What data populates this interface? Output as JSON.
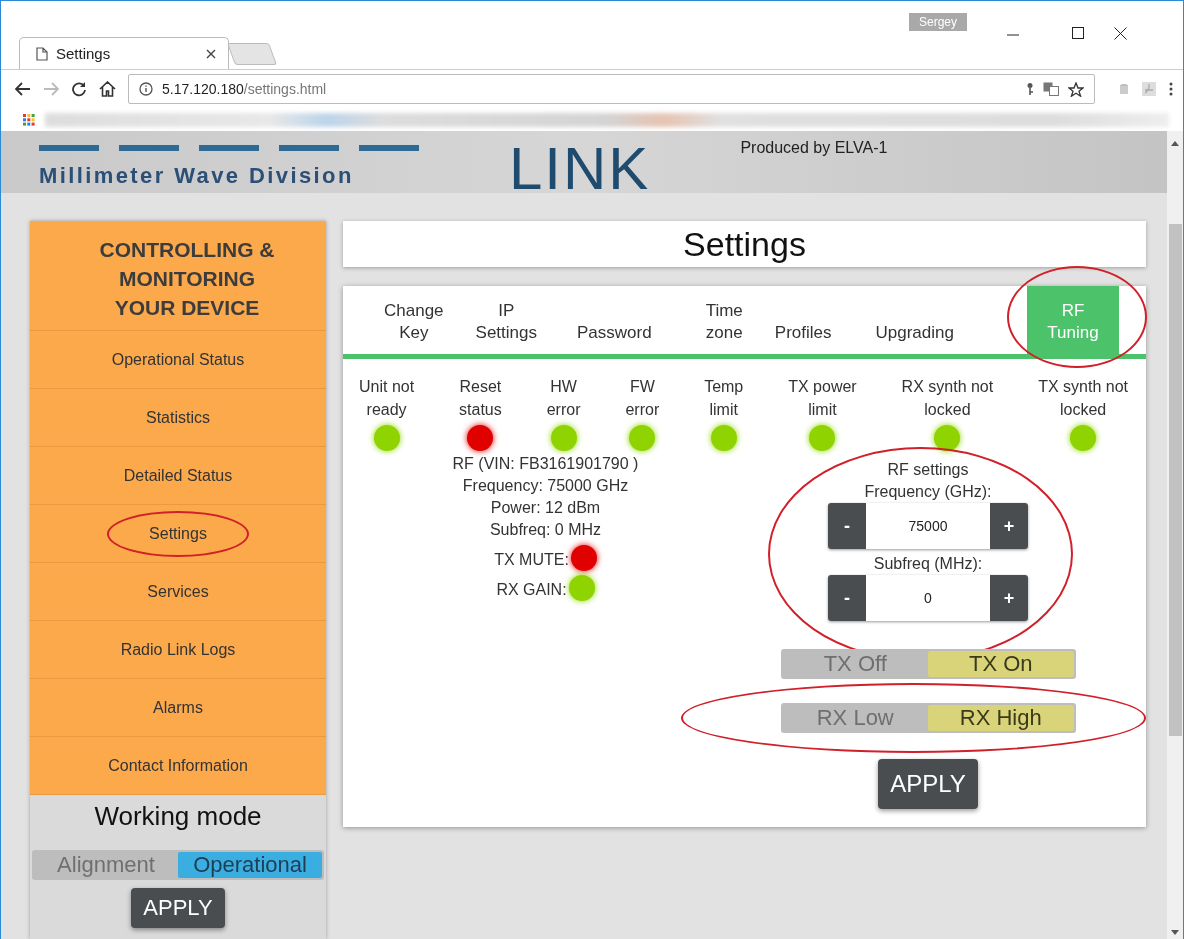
{
  "browser": {
    "tab_title": "Settings",
    "profile": "Sergey",
    "address": {
      "host": "5.17.120.180",
      "path": "/settings.html"
    }
  },
  "header": {
    "division": "Millimeter Wave Division",
    "product": "LINK",
    "produced": "Produced by ELVA-1"
  },
  "sidebar": {
    "heading": "CONTROLLING & MONITORING YOUR DEVICE",
    "items": [
      {
        "label": "Operational Status",
        "circled": false
      },
      {
        "label": "Statistics",
        "circled": false
      },
      {
        "label": "Detailed Status",
        "circled": false
      },
      {
        "label": "Settings",
        "circled": true
      },
      {
        "label": "Services",
        "circled": false
      },
      {
        "label": "Radio Link Logs",
        "circled": false
      },
      {
        "label": "Alarms",
        "circled": false
      },
      {
        "label": "Contact Information",
        "circled": false
      }
    ],
    "working_mode": {
      "title": "Working mode",
      "options": [
        {
          "label": "Alignment",
          "selected": false
        },
        {
          "label": "Operational",
          "selected": true
        }
      ],
      "apply": "APPLY"
    }
  },
  "page_title": "Settings",
  "tabs": [
    {
      "label": "Change\nKey",
      "selected": false,
      "circled": false
    },
    {
      "label": "IP\nSettings",
      "selected": false,
      "circled": false
    },
    {
      "label": "Password",
      "selected": false,
      "circled": false
    },
    {
      "label": "Time\nzone",
      "selected": false,
      "circled": false
    },
    {
      "label": "Profiles",
      "selected": false,
      "circled": false
    },
    {
      "label": "Upgrading",
      "selected": false,
      "circled": false
    },
    {
      "label": "RF\nTuning",
      "selected": true,
      "circled": true
    }
  ],
  "indicators": [
    {
      "label": "Unit not\nready",
      "color": "#8fd400"
    },
    {
      "label": "Reset\nstatus",
      "color": "#e00000"
    },
    {
      "label": "HW\nerror",
      "color": "#8fd400"
    },
    {
      "label": "FW\nerror",
      "color": "#8fd400"
    },
    {
      "label": "Temp\nlimit",
      "color": "#8fd400"
    },
    {
      "label": "TX power\nlimit",
      "color": "#8fd400"
    },
    {
      "label": "RX synth not\nlocked",
      "color": "#8fd400"
    },
    {
      "label": "TX synth not\nlocked",
      "color": "#8fd400"
    }
  ],
  "rf_info": {
    "lines": [
      "RF (VIN: FB3161901790 )",
      "Frequency: 75000 GHz",
      "Power: 12 dBm",
      "Subfreq: 0 MHz"
    ],
    "flags": [
      {
        "label": "TX MUTE:",
        "color": "#e00000"
      },
      {
        "label": "RX GAIN:",
        "color": "#8fd400"
      }
    ]
  },
  "rf_settings": {
    "title": "RF settings",
    "circled": true,
    "steppers": [
      {
        "label": "Frequency (GHz):",
        "value": "75000",
        "minus": "-",
        "plus": "+"
      },
      {
        "label": "Subfreq (MHz):",
        "value": "0",
        "minus": "-",
        "plus": "+"
      }
    ],
    "toggles": [
      {
        "circled": false,
        "options": [
          {
            "label": "TX Off",
            "selected": false
          },
          {
            "label": "TX On",
            "selected": true
          }
        ]
      },
      {
        "circled": true,
        "options": [
          {
            "label": "RX Low",
            "selected": false
          },
          {
            "label": "RX High",
            "selected": true
          }
        ]
      }
    ],
    "apply": "APPLY"
  }
}
